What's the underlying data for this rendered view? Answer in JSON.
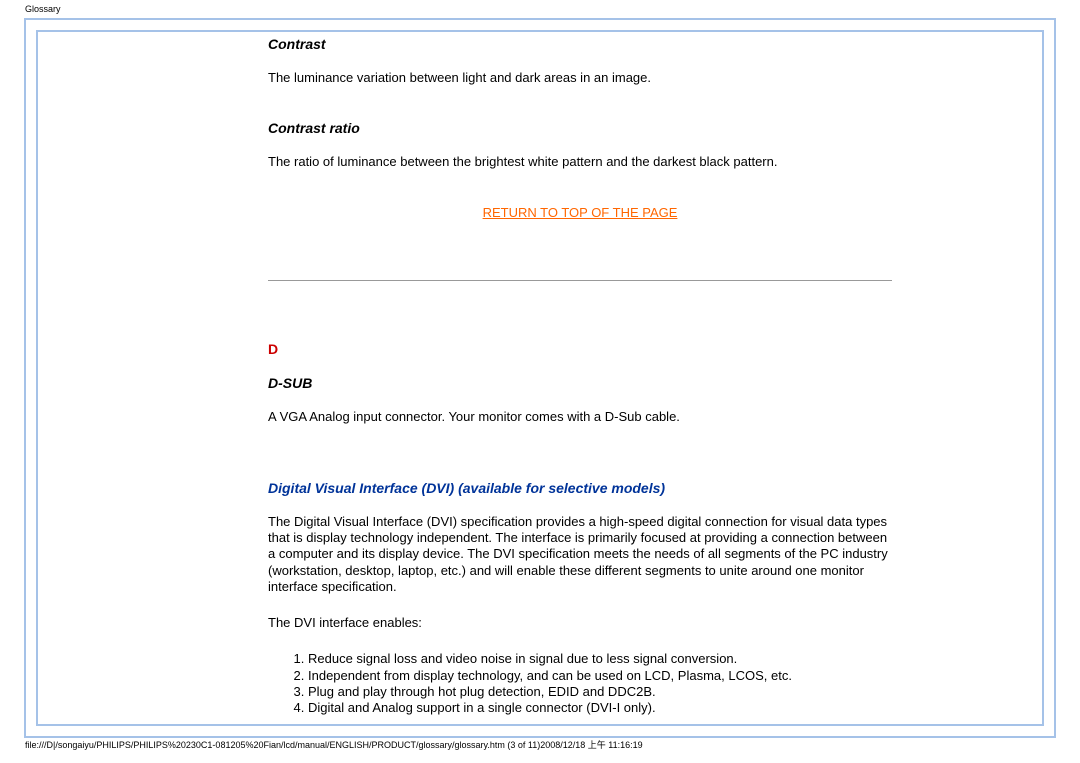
{
  "header": {
    "title": "Glossary"
  },
  "terms": {
    "contrast": {
      "heading": "Contrast",
      "body": "The luminance variation between light and dark areas in an image."
    },
    "contrast_ratio": {
      "heading": "Contrast ratio",
      "body": "The ratio of luminance between the brightest white pattern and the darkest black pattern."
    },
    "return_link": "RETURN TO TOP OF THE PAGE",
    "section_d": "D",
    "dsub": {
      "heading": "D-SUB",
      "body": "A VGA Analog input connector. Your monitor comes with a D-Sub cable."
    },
    "dvi": {
      "heading": "Digital Visual Interface (DVI) (available for selective models)",
      "body": "The Digital Visual Interface (DVI) specification provides a high-speed digital connection for visual data types that is display technology independent. The interface is primarily focused at providing a connection between a computer and its display device. The DVI specification meets the needs of all segments of the PC industry (workstation, desktop, laptop, etc.) and will enable these different segments to unite around one monitor interface specification.",
      "enables_intro": "The DVI interface enables:",
      "enables": [
        "Reduce signal loss and video noise in signal due to less signal conversion.",
        "Independent from display technology, and can be used on LCD, Plasma, LCOS, etc.",
        "Plug and play through hot plug detection, EDID and DDC2B.",
        "Digital and Analog support in a single connector (DVI-I only)."
      ]
    }
  },
  "footer": {
    "path": "file:///D|/songaiyu/PHILIPS/PHILIPS%20230C1-081205%20Fian/lcd/manual/ENGLISH/PRODUCT/glossary/glossary.htm (3 of 11)2008/12/18 上午 11:16:19"
  }
}
